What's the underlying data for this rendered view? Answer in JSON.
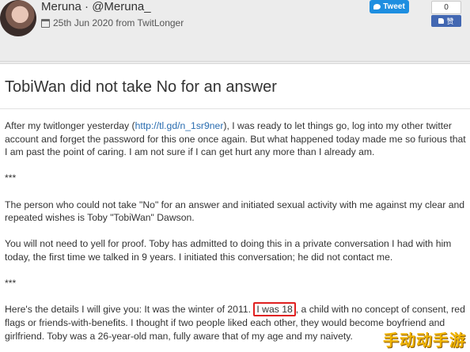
{
  "header": {
    "author": "Meruna · @Meruna_",
    "date": "25th Jun 2020 from TwitLonger",
    "tweet_label": "Tweet",
    "like_count": "0",
    "like_label": "赞"
  },
  "post": {
    "title": "TobiWan did not take No for an answer",
    "p1_before": "After my twitlonger yesterday (",
    "p1_link": "http://tl.gd/n_1sr9ner",
    "p1_after": "), I was ready to let things go, log into my other twitter account and forget the password for this one once again. But what happened today made me so furious that I am past the point of caring. I am not sure if I can get hurt any more than I already am.",
    "sep1": "***",
    "p2": "The person who could not take \"No\" for an answer and initiated sexual activity with me against my clear and repeated wishes is Toby \"TobiWan\" Dawson.",
    "p3": "You will not need to yell for proof. Toby has admitted to doing this in a private conversation I had with him today, the first time we talked in 9 years. I initiated this conversation; he did not contact me.",
    "sep2": "***",
    "p4_before": "Here's the details I will give you: It was the winter of 2011. ",
    "p4_highlight": "I was 18",
    "p4_after": ", a child with no concept of consent, red flags or friends-with-benefits. I thought if two people liked each other, they would become boyfriend and girlfriend. Toby was a 26-year-old man, fully aware that of my age and my naivety."
  },
  "watermark": "手动动手游",
  "colors": {
    "link": "#2a6db0",
    "highlight_border": "#e02020",
    "tweet_button": "#1d8ee0",
    "like_button": "#4267b2"
  }
}
